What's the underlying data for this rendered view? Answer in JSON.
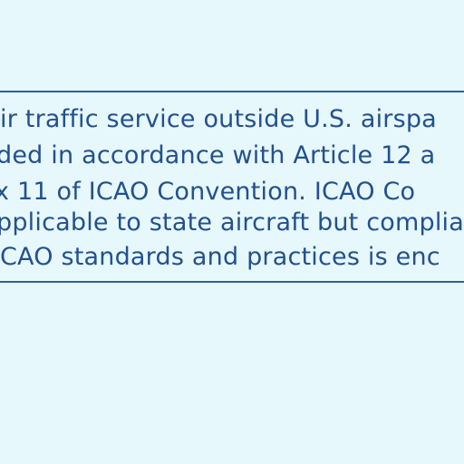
{
  "document": {
    "lines": [
      "ir traffic service outside U.S. airspa",
      "ded in accordance with Article 12 a",
      "x 11 of ICAO Convention.  ICAO Co",
      "pplicable to state aircraft but complia",
      "CAO standards and practices is enc"
    ]
  }
}
